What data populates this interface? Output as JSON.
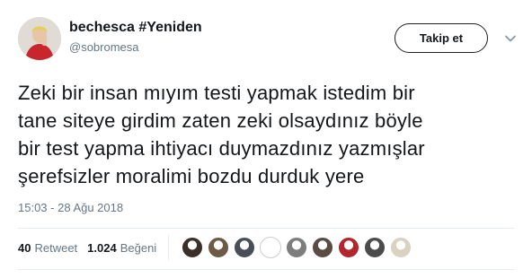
{
  "author": {
    "display_name": "bechesca #Yeniden",
    "handle": "@sobromesa"
  },
  "header": {
    "follow_label": "Takip et",
    "menu_icon": "chevron-down-icon"
  },
  "tweet": {
    "text_lines": [
      "Zeki bir insan mıyım testi yapmak istedim bir",
      "tane siteye girdim zaten zeki olsaydınız böyle",
      "bir test yapma ihtiyacı duymazdınız yazmışlar",
      "şerefsizler moralimi bozdu durduk yere"
    ],
    "timestamp": "15:03 - 28 Ağu 2018"
  },
  "stats": {
    "retweets_count": "40",
    "retweets_label": "Retweet",
    "likes_count": "1.024",
    "likes_label": "Beğeni"
  },
  "likers": {
    "avatar_colors": [
      "#3b2f2a",
      "#6b5a45",
      "#4a4f57",
      "#ffffff",
      "#7d7d7d",
      "#5a4b44",
      "#b3262d",
      "#4b4b4b",
      "#d9d2c0"
    ]
  },
  "colors": {
    "text_primary": "#14171a",
    "text_secondary": "#657786",
    "divider": "#e6ecf0"
  }
}
